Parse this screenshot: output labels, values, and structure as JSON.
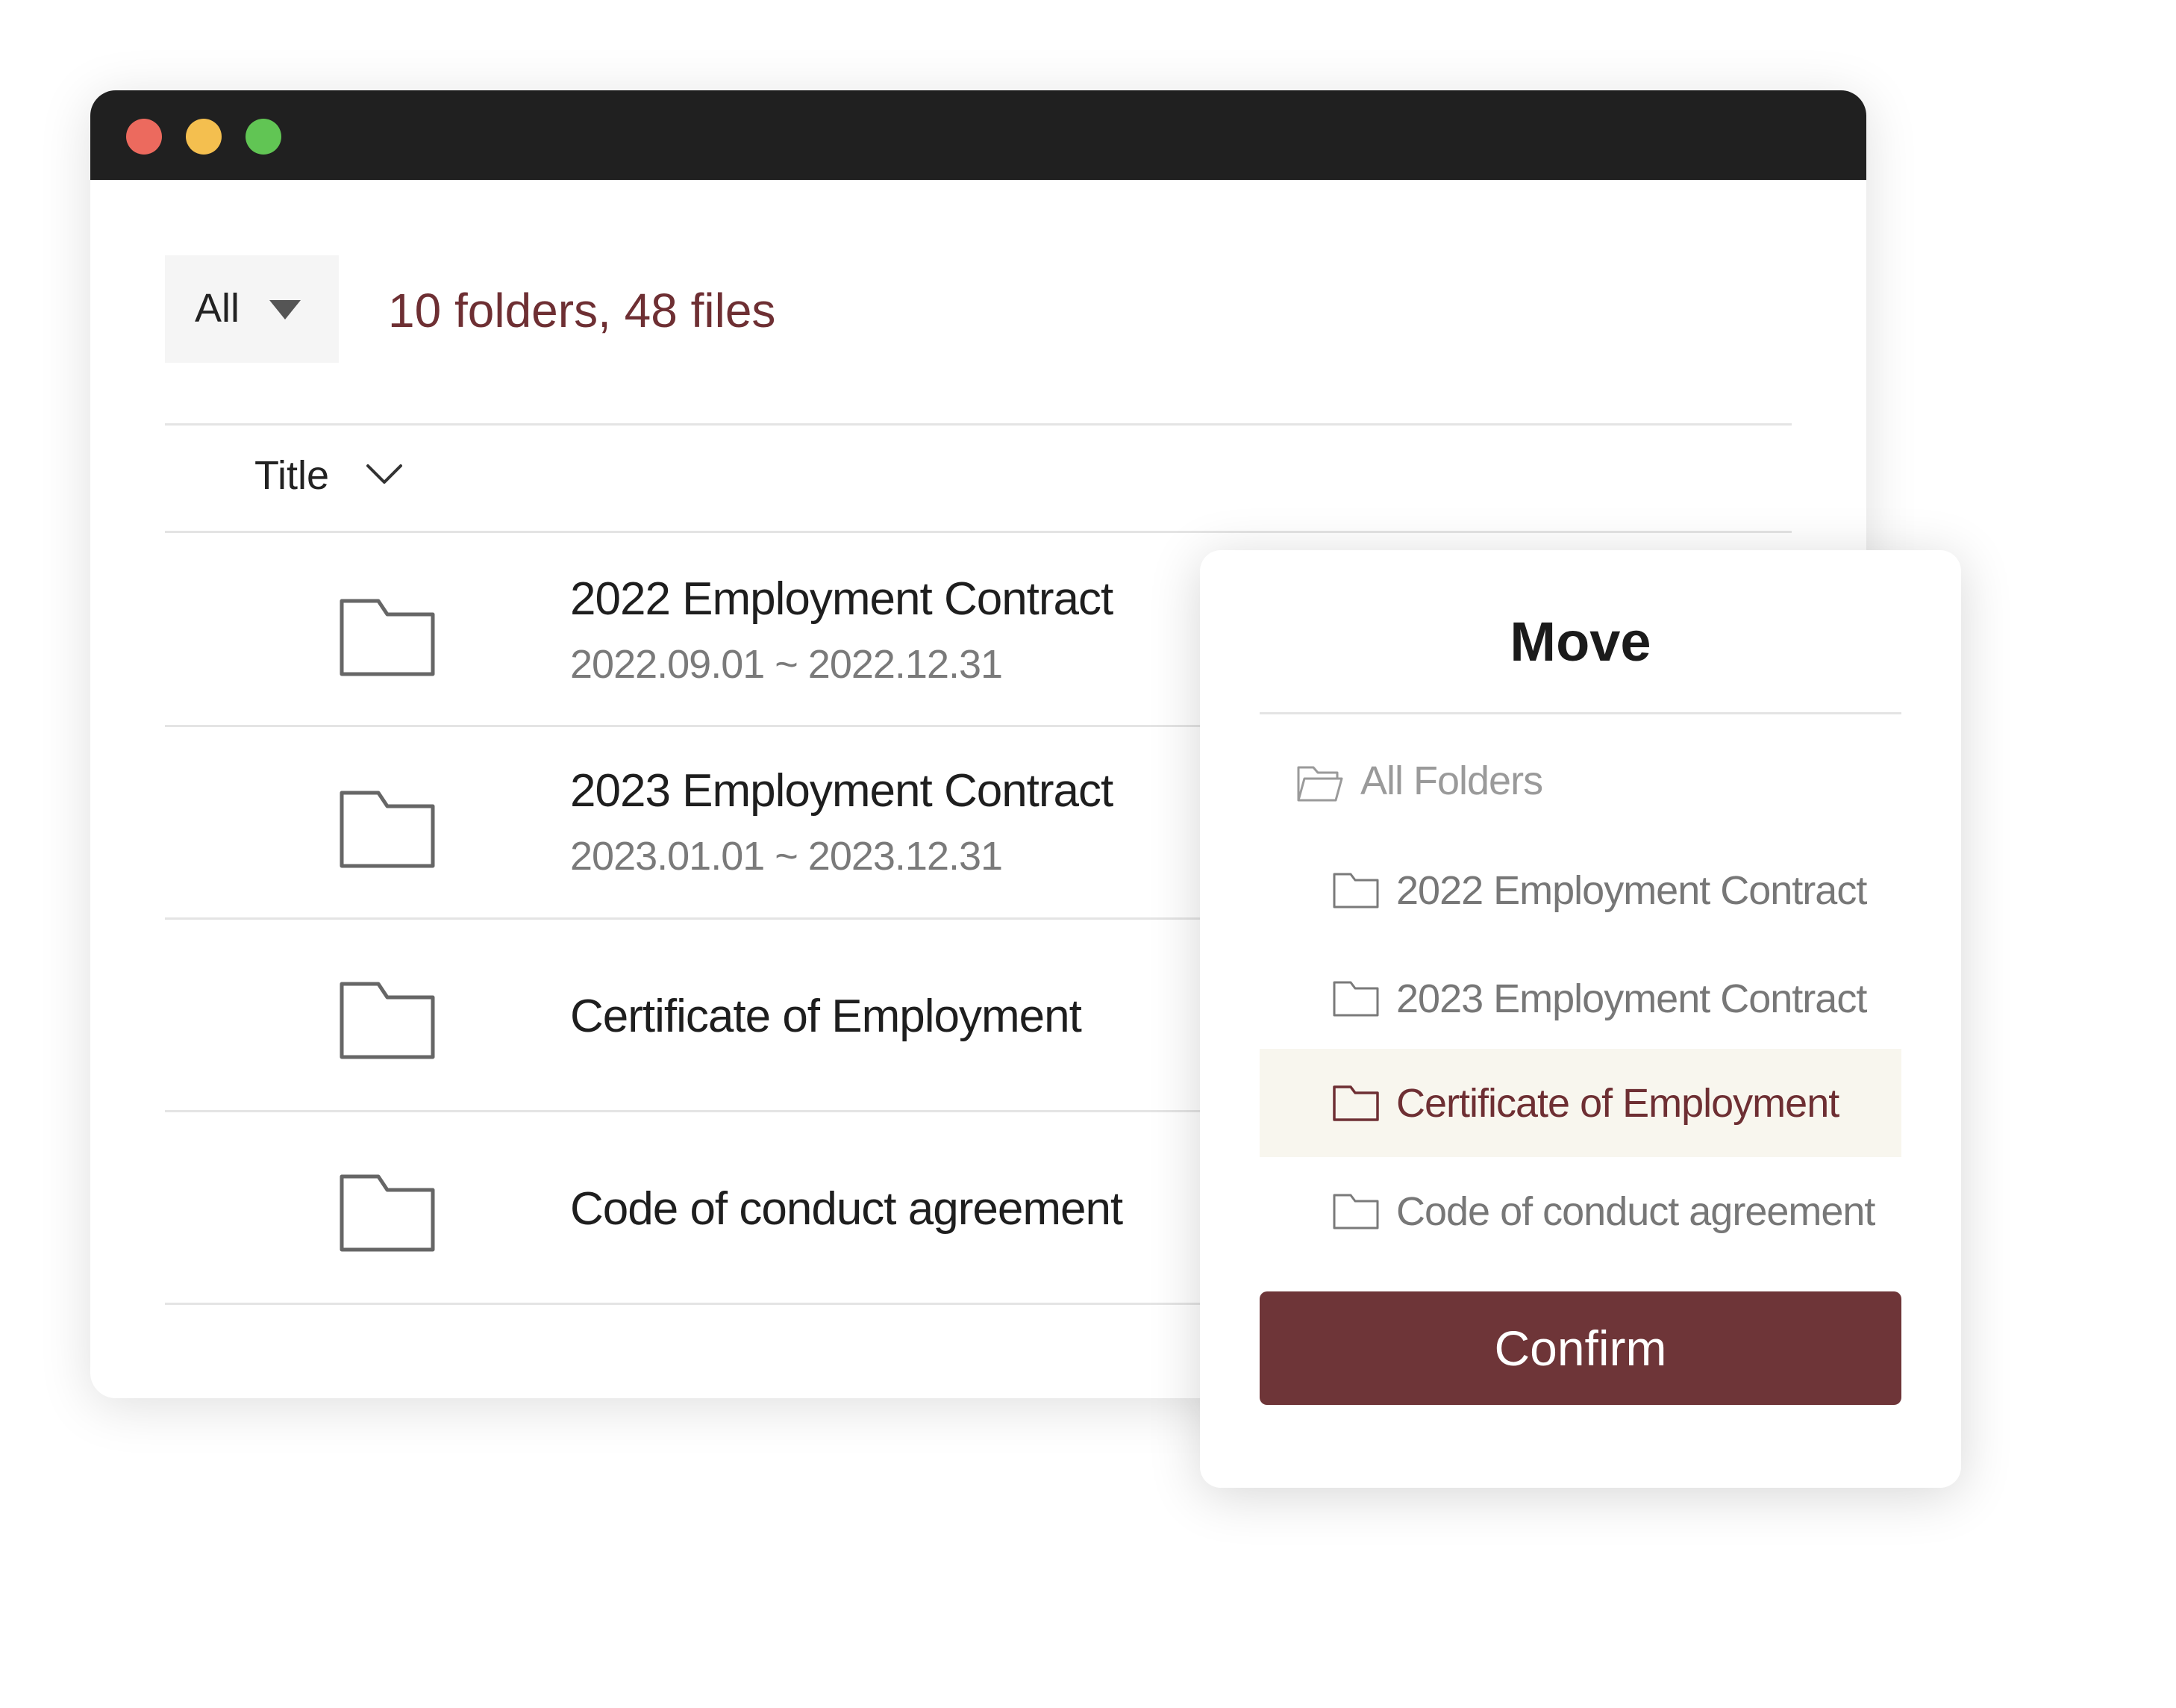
{
  "window": {
    "controls": [
      {
        "name": "close",
        "color": "#ec6a5e"
      },
      {
        "name": "minimize",
        "color": "#f4bf4f"
      },
      {
        "name": "zoom",
        "color": "#61c554"
      }
    ]
  },
  "toolbar": {
    "filter_value": "All",
    "summary": "10 folders, 48 files"
  },
  "table": {
    "sort_label": "Title",
    "rows": [
      {
        "title": "2022 Employment Contract",
        "date": "2022.09.01 ~ 2022.12.31",
        "icon": "folder-icon"
      },
      {
        "title": "2023 Employment Contract",
        "date": "2023.01.01 ~ 2023.12.31",
        "icon": "folder-icon"
      },
      {
        "title": "Certificate of Employment",
        "icon": "folder-icon"
      },
      {
        "title": "Code of conduct agreement",
        "icon": "folder-icon"
      }
    ]
  },
  "move_dialog": {
    "title": "Move",
    "root_label": "All Folders",
    "folders": [
      {
        "label": "2022 Employment Contract",
        "selected": false
      },
      {
        "label": "2023 Employment Contract",
        "selected": false
      },
      {
        "label": "Certificate of Employment",
        "selected": true
      },
      {
        "label": "Code of conduct agreement",
        "selected": false
      }
    ],
    "confirm_label": "Confirm"
  },
  "colors": {
    "accent": "#6e2f33",
    "button": "#6e3538",
    "selected_row": "#f8f6ee",
    "titlebar": "#202020"
  }
}
